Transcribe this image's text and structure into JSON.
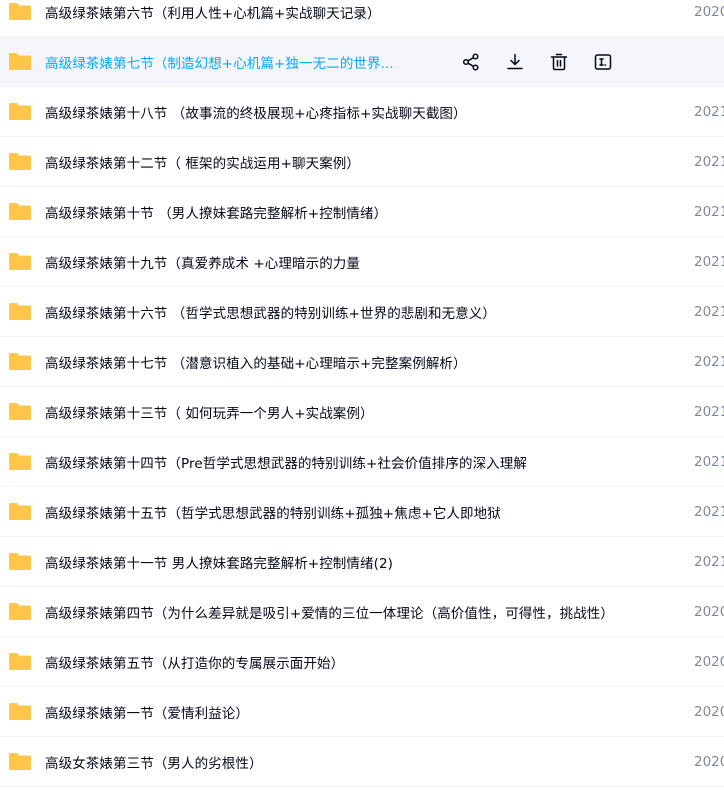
{
  "colors": {
    "folder": "#ffc64a",
    "hover_bg": "#f4f6fb",
    "link_blue": "#06a7ff",
    "text": "#03081a",
    "date_text": "#818999"
  },
  "hover_actions": [
    {
      "name": "share-icon"
    },
    {
      "name": "download-icon"
    },
    {
      "name": "delete-icon"
    },
    {
      "name": "rename-icon"
    }
  ],
  "files": [
    {
      "name": "高级绿茶婊第六节（利用人性+心机篇+实战聊天记录）",
      "date": "2020",
      "icon": "folder-icon"
    },
    {
      "name": "高级绿茶婊第七节（制造幻想+心机篇+独一无二的世界...",
      "date": "",
      "icon": "folder-icon",
      "hovered": true
    },
    {
      "name": "高级绿茶婊第十八节 （故事流的终极展现+心疼指标+实战聊天截图）",
      "date": "2021",
      "icon": "folder-icon"
    },
    {
      "name": "高级绿茶婊第十二节（  框架的实战运用+聊天案例）",
      "date": "2021",
      "icon": "folder-icon"
    },
    {
      "name": "高级绿茶婊第十节 （男人撩妹套路完整解析+控制情绪）",
      "date": "2021",
      "icon": "folder-icon"
    },
    {
      "name": "高级绿茶婊第十九节（真爱养成术 +心理暗示的力量",
      "date": "2021",
      "icon": "folder-icon"
    },
    {
      "name": "高级绿茶婊第十六节 （哲学式思想武器的特别训练+世界的悲剧和无意义）",
      "date": "2021",
      "icon": "folder-icon"
    },
    {
      "name": "高级绿茶婊第十七节 （潜意识植入的基础+心理暗示+完整案例解析）",
      "date": "2021",
      "icon": "folder-icon"
    },
    {
      "name": "高级绿茶婊第十三节（ 如何玩弄一个男人+实战案例）",
      "date": "2021",
      "icon": "folder-icon"
    },
    {
      "name": "高级绿茶婊第十四节（Pre哲学式思想武器的特别训练+社会价值排序的深入理解",
      "date": "2021",
      "icon": "folder-icon"
    },
    {
      "name": "高级绿茶婊第十五节（哲学式思想武器的特别训练+孤独+焦虑+它人即地狱",
      "date": "2021",
      "icon": "folder-icon"
    },
    {
      "name": "高级绿茶婊第十一节 男人撩妹套路完整解析+控制情绪(2)",
      "date": "2021",
      "icon": "folder-icon"
    },
    {
      "name": "高级绿茶婊第四节（为什么差异就是吸引+爱情的三位一体理论（高价值性，可得性，挑战性）",
      "date": "2020",
      "icon": "folder-icon"
    },
    {
      "name": "高级绿茶婊第五节（从打造你的专属展示面开始）",
      "date": "2020",
      "icon": "folder-icon"
    },
    {
      "name": "高级绿茶婊第一节（爱情利益论）",
      "date": "2020",
      "icon": "folder-icon"
    },
    {
      "name": "高级女茶婊第三节（男人的劣根性）",
      "date": "2020",
      "icon": "folder-icon"
    }
  ]
}
